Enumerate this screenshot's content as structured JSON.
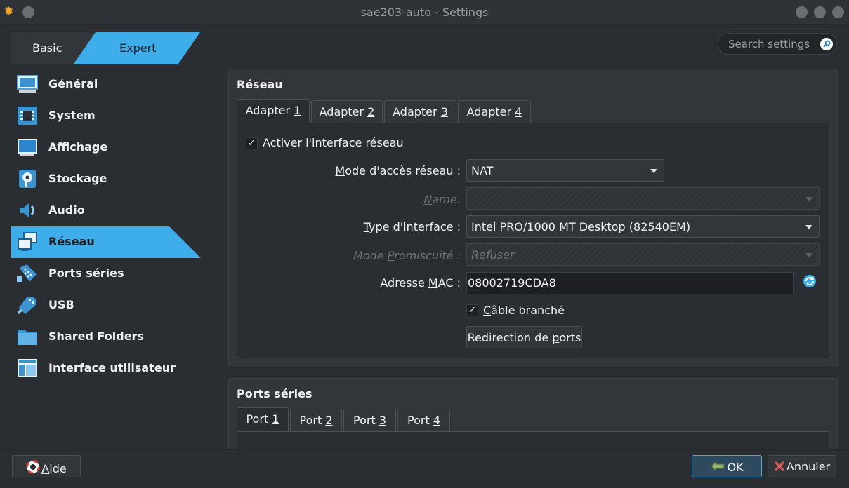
{
  "window": {
    "title": "sae203-auto - Settings"
  },
  "mode": {
    "basic": "Basic",
    "expert": "Expert"
  },
  "search": {
    "placeholder": "Search settings"
  },
  "sidebar": {
    "items": [
      {
        "label": "Général",
        "icon": "general-icon"
      },
      {
        "label": "System",
        "icon": "system-icon"
      },
      {
        "label": "Affichage",
        "icon": "display-icon"
      },
      {
        "label": "Stockage",
        "icon": "storage-icon"
      },
      {
        "label": "Audio",
        "icon": "audio-icon"
      },
      {
        "label": "Réseau",
        "icon": "network-icon",
        "active": true
      },
      {
        "label": "Ports séries",
        "icon": "serial-ports-icon"
      },
      {
        "label": "USB",
        "icon": "usb-icon"
      },
      {
        "label": "Shared Folders",
        "icon": "shared-folders-icon"
      },
      {
        "label": "Interface utilisateur",
        "icon": "user-interface-icon"
      }
    ]
  },
  "network": {
    "title": "Réseau",
    "tabs": [
      {
        "prefix": "Adapter ",
        "num": "1"
      },
      {
        "prefix": "Adapter ",
        "num": "2"
      },
      {
        "prefix": "Adapter ",
        "num": "3"
      },
      {
        "prefix": "Adapter ",
        "num": "4"
      }
    ],
    "enable_label": "Activer l'interface réseau",
    "enable_checked": true,
    "mode_label_pre": "",
    "mode_label_u": "M",
    "mode_label_post": "ode d'accès réseau :",
    "mode_value": "NAT",
    "name_label_u": "N",
    "name_label_post": "ame:",
    "name_value": "",
    "type_label_u": "T",
    "type_label_post": "ype d'interface :",
    "type_value": "Intel PRO/1000 MT Desktop (82540EM)",
    "promisc_label_pre": "Mode ",
    "promisc_label_u": "P",
    "promisc_label_post": "romiscuité :",
    "promisc_value": "Refuser",
    "mac_label_pre": "Adresse ",
    "mac_label_u": "M",
    "mac_label_post": "AC :",
    "mac_value": "08002719CDA8",
    "cable_label_u": "C",
    "cable_label_post": "âble branché",
    "cable_checked": true,
    "port_fwd_pre": "Redirection de ",
    "port_fwd_u": "p",
    "port_fwd_post": "orts"
  },
  "serial": {
    "title": "Ports séries",
    "tabs": [
      {
        "prefix": "Port ",
        "num": "1"
      },
      {
        "prefix": "Port ",
        "num": "2"
      },
      {
        "prefix": "Port ",
        "num": "3"
      },
      {
        "prefix": "Port ",
        "num": "4"
      }
    ]
  },
  "footer": {
    "help_u": "A",
    "help_post": "ide",
    "ok": "OK",
    "cancel": "Annuler"
  },
  "colors": {
    "accent": "#3daee9",
    "background": "#2a2e32",
    "panel": "#31363b",
    "text": "#eff0f1"
  }
}
